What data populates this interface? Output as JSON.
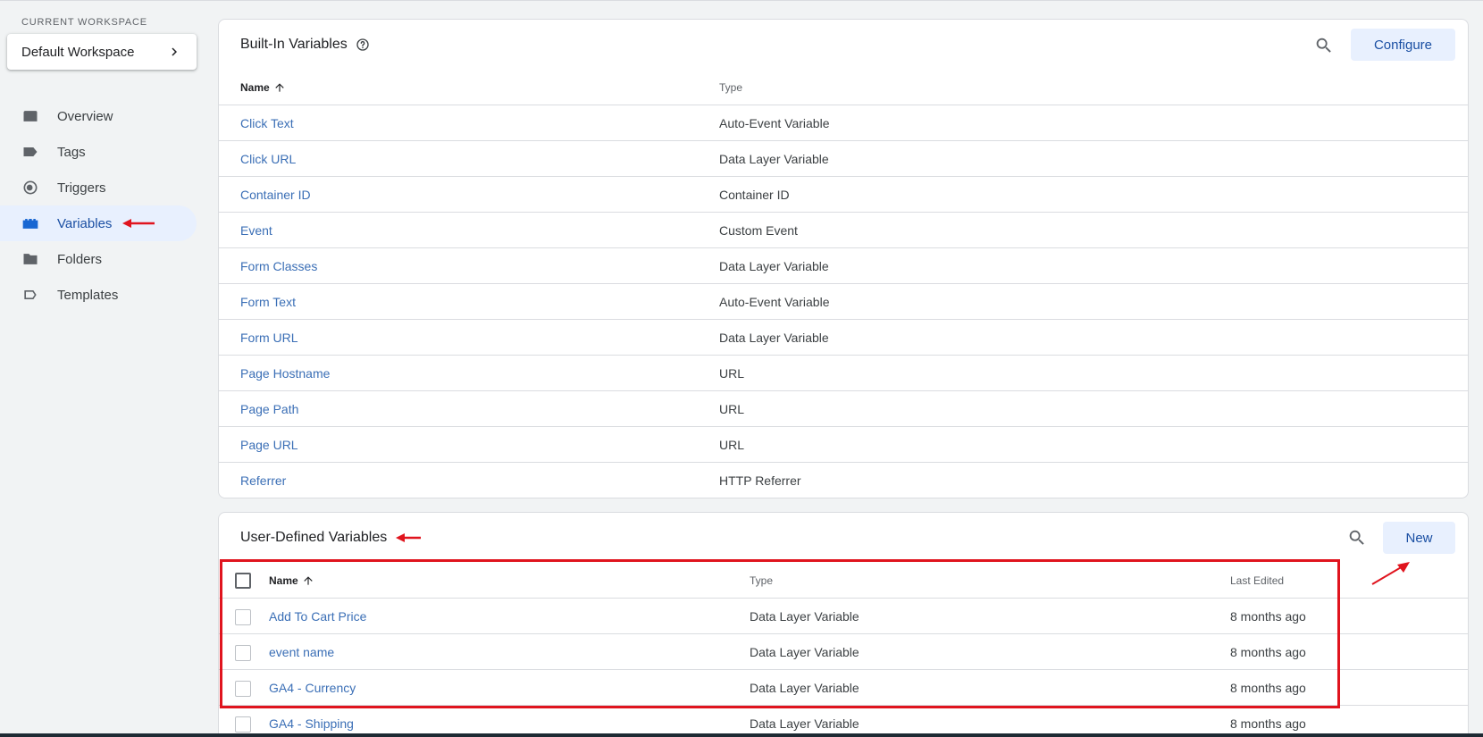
{
  "workspace": {
    "label": "CURRENT WORKSPACE",
    "name": "Default Workspace"
  },
  "nav": {
    "items": [
      {
        "label": "Overview",
        "icon": "overview-icon"
      },
      {
        "label": "Tags",
        "icon": "tag-icon"
      },
      {
        "label": "Triggers",
        "icon": "trigger-icon"
      },
      {
        "label": "Variables",
        "icon": "variables-icon",
        "active": true
      },
      {
        "label": "Folders",
        "icon": "folder-icon"
      },
      {
        "label": "Templates",
        "icon": "template-icon"
      }
    ]
  },
  "builtin": {
    "title": "Built-In Variables",
    "configure_label": "Configure",
    "columns": {
      "name": "Name",
      "type": "Type"
    },
    "rows": [
      {
        "name": "Click Text",
        "type": "Auto-Event Variable"
      },
      {
        "name": "Click URL",
        "type": "Data Layer Variable"
      },
      {
        "name": "Container ID",
        "type": "Container ID"
      },
      {
        "name": "Event",
        "type": "Custom Event"
      },
      {
        "name": "Form Classes",
        "type": "Data Layer Variable"
      },
      {
        "name": "Form Text",
        "type": "Auto-Event Variable"
      },
      {
        "name": "Form URL",
        "type": "Data Layer Variable"
      },
      {
        "name": "Page Hostname",
        "type": "URL"
      },
      {
        "name": "Page Path",
        "type": "URL"
      },
      {
        "name": "Page URL",
        "type": "URL"
      },
      {
        "name": "Referrer",
        "type": "HTTP Referrer"
      }
    ]
  },
  "userdefined": {
    "title": "User-Defined Variables",
    "new_label": "New",
    "columns": {
      "name": "Name",
      "type": "Type",
      "edited": "Last Edited"
    },
    "rows": [
      {
        "name": "Add To Cart Price",
        "type": "Data Layer Variable",
        "edited": "8 months ago"
      },
      {
        "name": "event name",
        "type": "Data Layer Variable",
        "edited": "8 months ago"
      },
      {
        "name": "GA4 - Currency",
        "type": "Data Layer Variable",
        "edited": "8 months ago"
      },
      {
        "name": "GA4 - Shipping",
        "type": "Data Layer Variable",
        "edited": "8 months ago"
      }
    ]
  },
  "colors": {
    "accent": "#1967d2",
    "link": "#3b6fb6",
    "annotation": "#e0141e"
  }
}
